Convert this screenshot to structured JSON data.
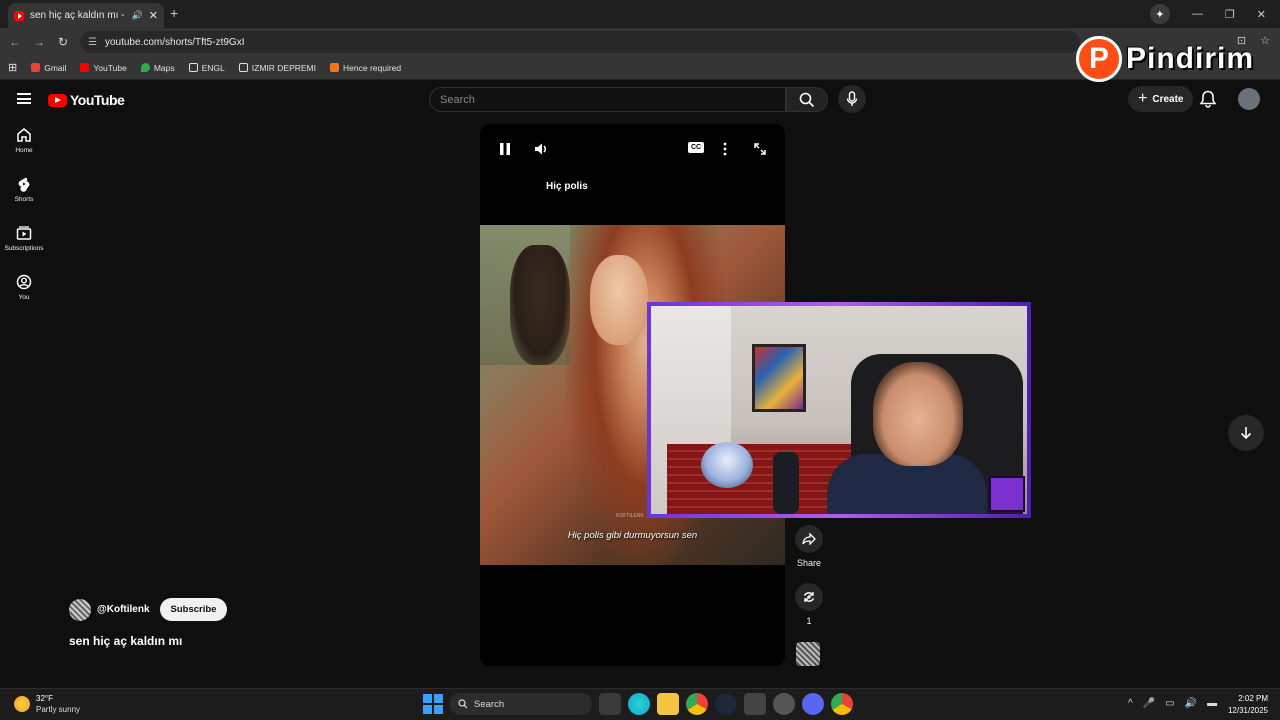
{
  "browser": {
    "tab_title": "sen hiç aç kaldın mı - YouTube",
    "tab_audio_icon": "speaker-icon",
    "url": "youtube.com/shorts/Tft5-zt9GxI",
    "bookmarks": [
      {
        "label": "Gmail",
        "icon": "gmail-icon",
        "color": "#ea4335"
      },
      {
        "label": "YouTube",
        "icon": "youtube-icon",
        "color": "#ff0000"
      },
      {
        "label": "Maps",
        "icon": "maps-icon",
        "color": "#34a853"
      },
      {
        "label": "ENGL",
        "icon": "folder-icon",
        "color": "#e0e0e0"
      },
      {
        "label": "IZMIR DEPREMI",
        "icon": "folder-icon",
        "color": "#e0e0e0"
      },
      {
        "label": "Hence required",
        "icon": "site-icon",
        "color": "#f97316"
      }
    ]
  },
  "overlay_logo": {
    "letter": "P",
    "text": "Pindirim"
  },
  "youtube": {
    "logo_text": "YouTube",
    "search_placeholder": "Search",
    "create_label": "Create",
    "sidebar": [
      {
        "label": "Home",
        "icon": "home-icon"
      },
      {
        "label": "Shorts",
        "icon": "shorts-icon"
      },
      {
        "label": "Subscriptions",
        "icon": "subscriptions-icon"
      },
      {
        "label": "You",
        "icon": "you-icon"
      }
    ],
    "player": {
      "top_text": "Hiç polis",
      "subtitle": "Hiç polis gibi durmuyorsun sen",
      "watermark": "KOFTILENK",
      "cc_label": "CC"
    },
    "actions": {
      "share_label": "Share",
      "remix_count": "1"
    },
    "channel": {
      "handle": "@Koftilenk",
      "subscribe_label": "Subscribe"
    },
    "video_title": "sen hiç aç kaldın mı"
  },
  "taskbar": {
    "temperature": "32°F",
    "weather": "Partly sunny",
    "search_label": "Search",
    "time": "2:02 PM",
    "date": "12/31/2025"
  },
  "colors": {
    "accent_red": "#ff0000",
    "cam_frame": "#8b3ff0",
    "logo_orange": "#ff4d14"
  }
}
